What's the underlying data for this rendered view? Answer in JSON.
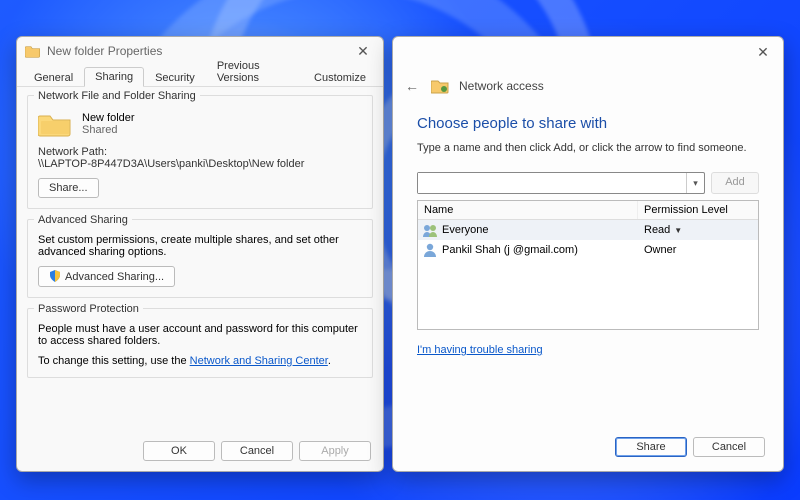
{
  "properties": {
    "title": "New folder Properties",
    "tabs": [
      "General",
      "Sharing",
      "Security",
      "Previous Versions",
      "Customize"
    ],
    "active_tab": 1,
    "section_nffs": {
      "title": "Network File and Folder Sharing",
      "item_name": "New folder",
      "item_status": "Shared",
      "path_label": "Network Path:",
      "path_value": "\\\\LAPTOP-8P447D3A\\Users\\panki\\Desktop\\New folder",
      "share_btn": "Share..."
    },
    "section_adv": {
      "title": "Advanced Sharing",
      "desc": "Set custom permissions, create multiple shares, and set other advanced sharing options.",
      "btn": "Advanced Sharing..."
    },
    "section_pw": {
      "title": "Password Protection",
      "desc": "People must have a user account and password for this computer to access shared folders.",
      "change_prefix": "To change this setting, use the ",
      "link": "Network and Sharing Center",
      "change_suffix": "."
    },
    "buttons": {
      "ok": "OK",
      "cancel": "Cancel",
      "apply": "Apply"
    }
  },
  "network": {
    "title": "Network access",
    "heading": "Choose people to share with",
    "sub": "Type a name and then click Add, or click the arrow to find someone.",
    "add_btn": "Add",
    "columns": {
      "name": "Name",
      "perm": "Permission Level"
    },
    "rows": [
      {
        "icon": "group",
        "name": "Everyone",
        "perm": "Read",
        "has_dropdown": true,
        "selected": true
      },
      {
        "icon": "user",
        "name": "Pankil Shah (j                  @gmail.com)",
        "perm": "Owner",
        "has_dropdown": false,
        "selected": false
      }
    ],
    "trouble_link": "I'm having trouble sharing",
    "buttons": {
      "share": "Share",
      "cancel": "Cancel"
    }
  }
}
